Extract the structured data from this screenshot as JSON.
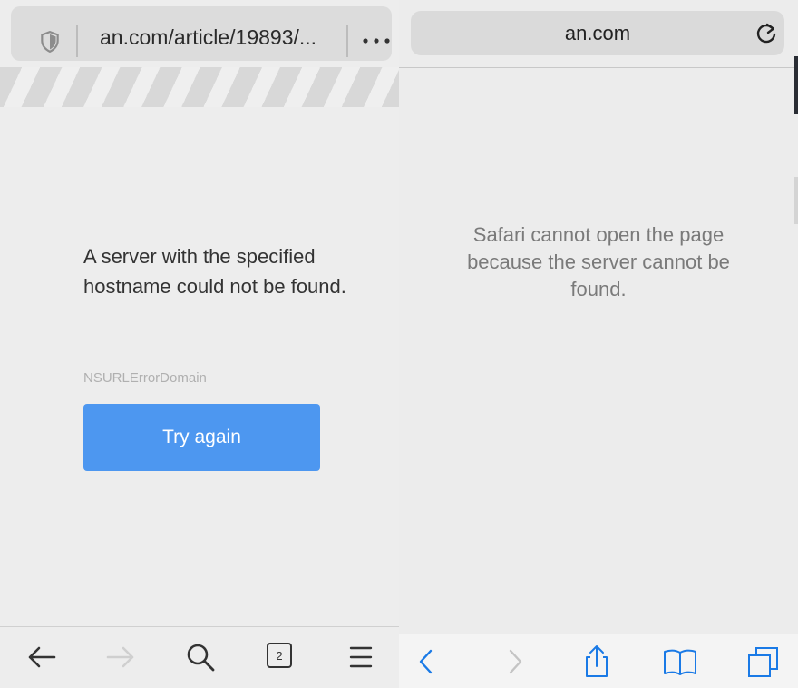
{
  "left": {
    "url_text": "an.com/article/19893/...",
    "message": "A server with the specified hostname could not be found.",
    "error_domain": "NSURLErrorDomain",
    "retry_button": "Try again",
    "toolbar": {
      "tab_count": "2",
      "icons": [
        "back-arrow-icon",
        "forward-arrow-icon",
        "search-icon",
        "tabs-icon",
        "menu-icon"
      ]
    },
    "icons": {
      "security": "shield-icon",
      "more": "more-dots-icon"
    },
    "colors": {
      "button": "#4d97f0",
      "background": "#ededed"
    }
  },
  "right": {
    "url_text": "an.com",
    "message": "Safari cannot open the page because the server cannot be found.",
    "icons": {
      "reload": "reload-icon"
    },
    "toolbar": {
      "icons": [
        "back-chevron-icon",
        "forward-chevron-icon",
        "share-icon",
        "bookmarks-icon",
        "tabs-icon"
      ]
    },
    "colors": {
      "accent": "#1a7ae6",
      "background": "#ececec"
    }
  }
}
